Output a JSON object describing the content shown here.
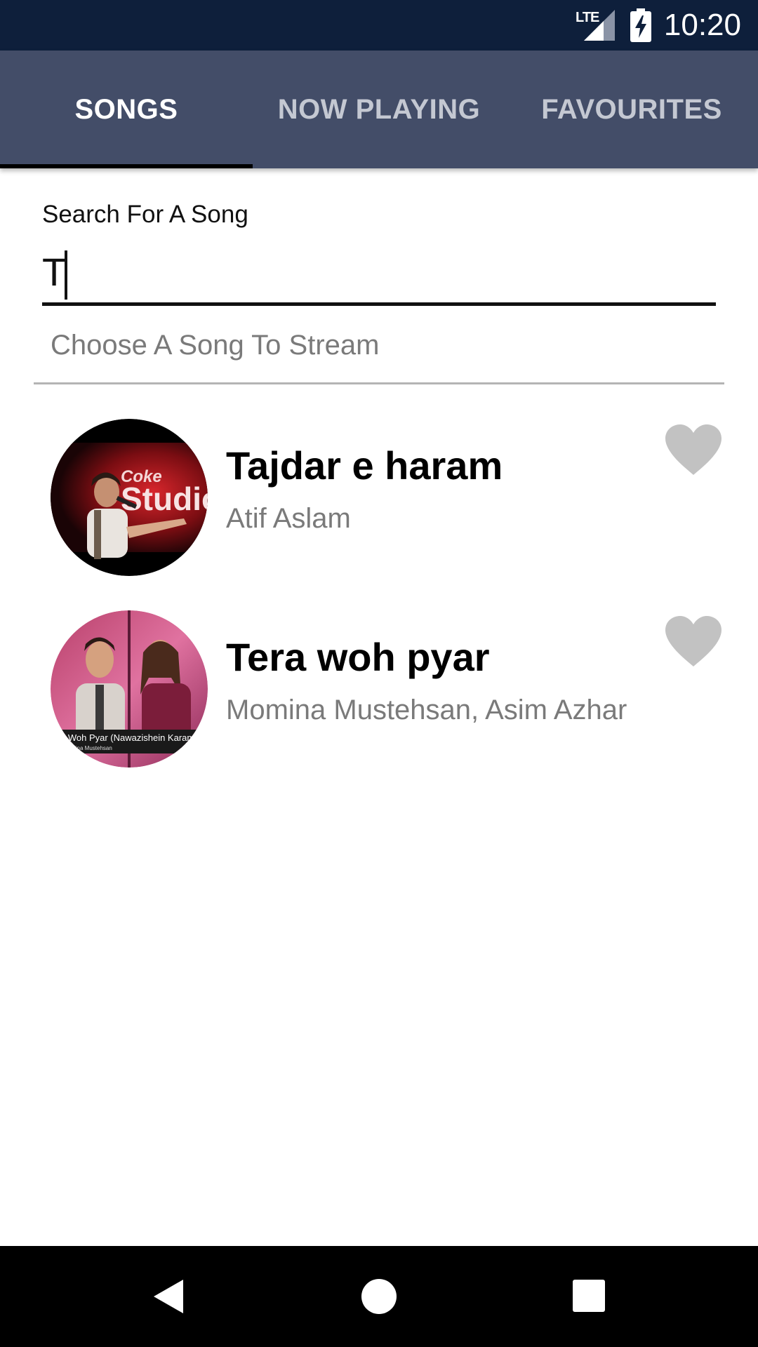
{
  "status_bar": {
    "network": "LTE",
    "time": "10:20"
  },
  "tabs": [
    {
      "label": "SONGS",
      "active": true
    },
    {
      "label": "NOW PLAYING",
      "active": false
    },
    {
      "label": "FAVOURITES",
      "active": false
    }
  ],
  "search": {
    "label": "Search For A Song",
    "value": "T"
  },
  "song_picker": {
    "prompt": "Choose A Song To Stream"
  },
  "songs": [
    {
      "title": "Tajdar e haram",
      "artist": "Atif Aslam",
      "favourite": false
    },
    {
      "title": "Tera woh pyar",
      "artist": "Momina Mustehsan, Asim Azhar",
      "favourite": false
    }
  ],
  "colors": {
    "status_bar": "#0e1f3b",
    "tab_bar": "#434d68",
    "tab_indicator": "#000000",
    "heart_inactive": "#c2c2c2",
    "secondary_text": "#7a7a7a"
  },
  "icons": {
    "fav": "heart-icon",
    "nav": [
      "back-icon",
      "home-icon",
      "recents-icon"
    ]
  }
}
